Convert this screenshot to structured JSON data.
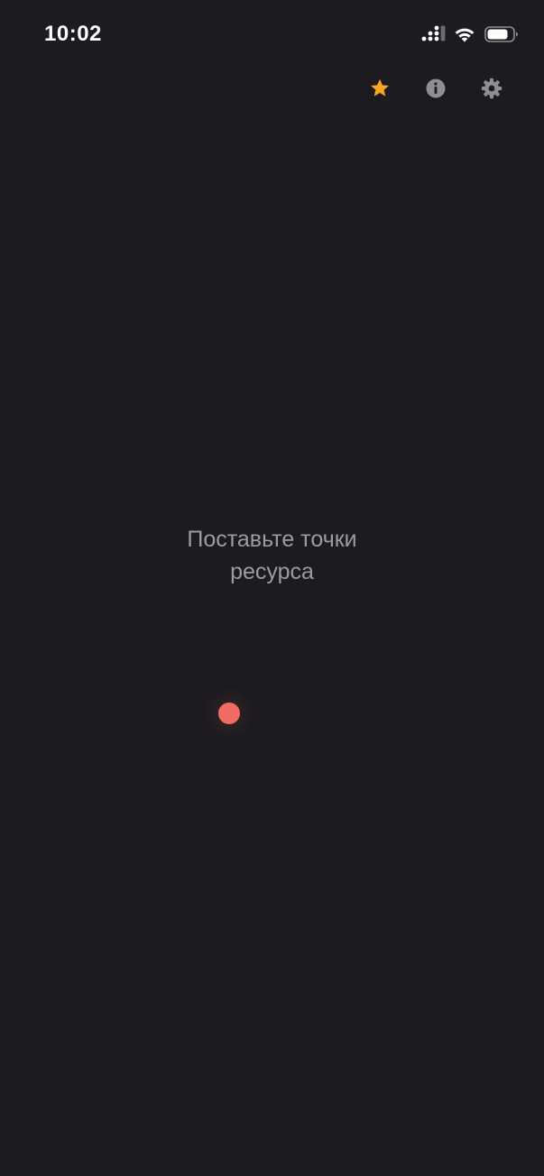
{
  "status_bar": {
    "time": "10:02",
    "icons": [
      "cellular-signal-icon",
      "wifi-icon",
      "battery-icon"
    ]
  },
  "toolbar": {
    "buttons": [
      {
        "icon": "star-icon",
        "color": "#f5a623"
      },
      {
        "icon": "info-icon",
        "color": "#8e8e93"
      },
      {
        "icon": "gear-icon",
        "color": "#8e8e93"
      }
    ]
  },
  "main": {
    "prompt_line1": "Поставьте точки",
    "prompt_line2": "ресурса"
  },
  "touch_point": {
    "color": "#ef6b63"
  },
  "theme": {
    "background": "#1c1b20",
    "text_muted": "#9c9ba0"
  }
}
